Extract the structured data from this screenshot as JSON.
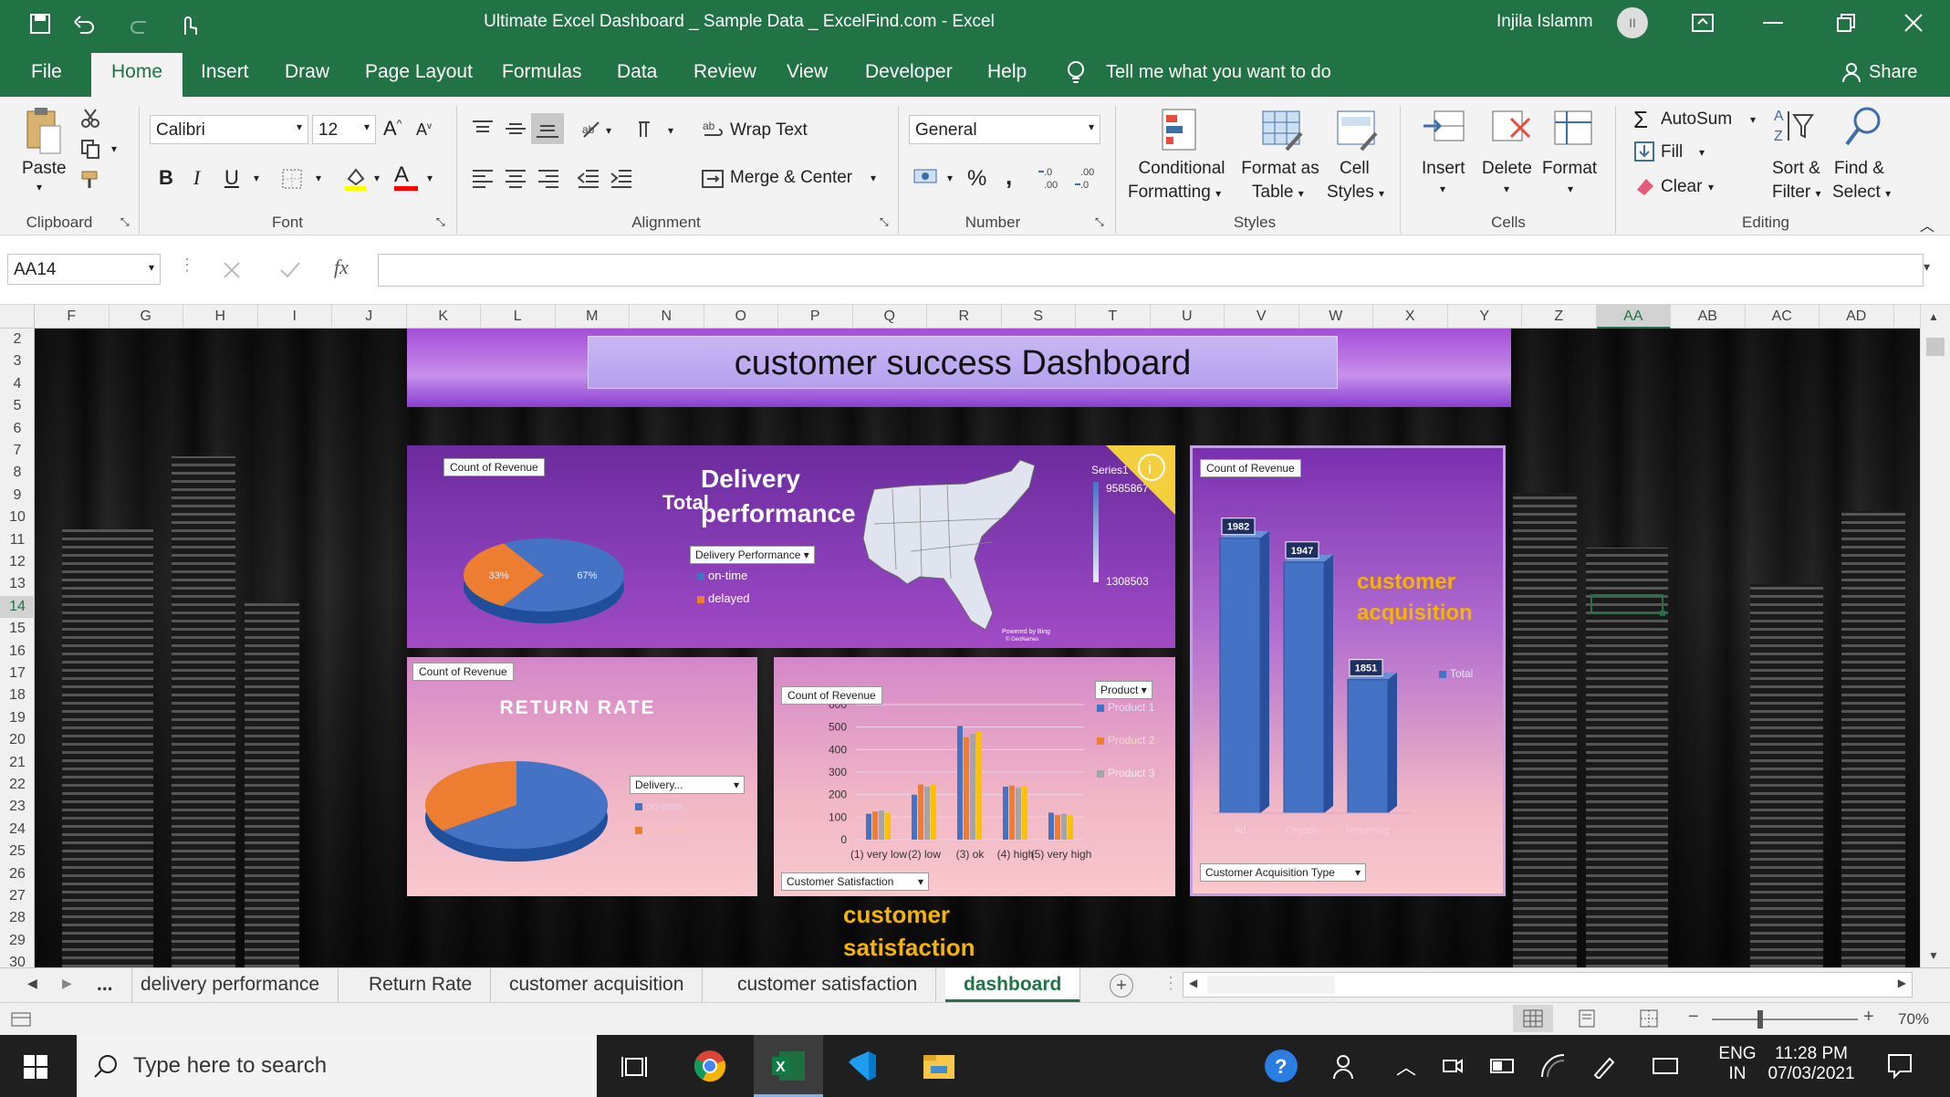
{
  "window": {
    "title": "Ultimate Excel Dashboard _ Sample Data _ ExcelFind.com  -  Excel",
    "user": "Injila Islamm",
    "user_initials": "II"
  },
  "tabs": [
    "File",
    "Home",
    "Insert",
    "Draw",
    "Page Layout",
    "Formulas",
    "Data",
    "Review",
    "View",
    "Developer",
    "Help"
  ],
  "tell_me": "Tell me what you want to do",
  "share": "Share",
  "ribbon": {
    "clipboard": {
      "paste": "Paste",
      "label": "Clipboard"
    },
    "font": {
      "name": "Calibri",
      "size": "12",
      "label": "Font",
      "bold": "B",
      "italic": "I",
      "underline": "U"
    },
    "alignment": {
      "wrap": "Wrap Text",
      "merge": "Merge & Center",
      "label": "Alignment"
    },
    "number": {
      "format": "General",
      "percent": "%",
      "comma": ",",
      "label": "Number"
    },
    "styles": {
      "conditional": "Conditional",
      "formatting": "Formatting",
      "format_as": "Format as",
      "table": "Table",
      "cell": "Cell",
      "cell_styles": "Styles",
      "label": "Styles"
    },
    "cells": {
      "insert": "Insert",
      "delete": "Delete",
      "format": "Format",
      "label": "Cells"
    },
    "editing": {
      "autosum": "AutoSum",
      "fill": "Fill",
      "clear": "Clear",
      "sort": "Sort &",
      "filter": "Filter",
      "find": "Find &",
      "select": "Select",
      "label": "Editing"
    }
  },
  "formula": {
    "namebox": "AA14",
    "fx": "fx",
    "value": ""
  },
  "columns": [
    "F",
    "G",
    "H",
    "I",
    "J",
    "K",
    "L",
    "M",
    "N",
    "O",
    "P",
    "Q",
    "R",
    "S",
    "T",
    "U",
    "V",
    "W",
    "X",
    "Y",
    "Z",
    "AA",
    "AB",
    "AC",
    "AD"
  ],
  "rows": [
    "2",
    "3",
    "4",
    "5",
    "6",
    "7",
    "8",
    "9",
    "10",
    "11",
    "12",
    "13",
    "14",
    "15",
    "16",
    "17",
    "18",
    "19",
    "20",
    "21",
    "22",
    "23",
    "24",
    "25",
    "26",
    "27",
    "28",
    "29",
    "30"
  ],
  "dashboard": {
    "title": "customer success Dashboard",
    "delivery": {
      "pill": "Count of Revenue",
      "title_line1": "Delivery",
      "title_line2": "performance",
      "total": "Total",
      "filter": "Delivery Performance",
      "legend": [
        "on-time",
        "delayed"
      ],
      "map_series": "Series1",
      "map_max": "9585867",
      "map_min": "1308503",
      "map_credit": "Powered by Bing",
      "map_credit2": "© GeoNames"
    },
    "return": {
      "pill": "Count of Revenue",
      "title": "RETURN RATE",
      "filter": "Delivery...",
      "legend": [
        "on-time",
        "delayed"
      ]
    },
    "satisfaction": {
      "pill": "Count of Revenue",
      "filter": "Product",
      "legend": [
        "Product 1",
        "Product 2",
        "Product 3"
      ],
      "axis_filter": "Customer Satisfaction",
      "caption_line1": "customer",
      "caption_line2": "satisfaction"
    },
    "acquisition": {
      "pill": "Count of Revenue",
      "title_line1": "customer",
      "title_line2": "acquisition",
      "legend": "Total",
      "filter": "Customer Acquisition Type"
    }
  },
  "chart_data": [
    {
      "type": "pie",
      "title": "Delivery performance",
      "categories": [
        "on-time",
        "delayed"
      ],
      "values": [
        67,
        33
      ],
      "labels": [
        "67%",
        "33%"
      ]
    },
    {
      "type": "pie",
      "title": "RETURN RATE",
      "categories": [
        "on-time",
        "delayed"
      ],
      "values": [
        65,
        35
      ]
    },
    {
      "type": "bar",
      "categories": [
        "(1) very low",
        "(2) low",
        "(3) ok",
        "(4) high",
        "(5) very high"
      ],
      "ylim": [
        0,
        600
      ],
      "yticks": [
        "0",
        "100",
        "200",
        "300",
        "400",
        "500",
        "600"
      ],
      "series": [
        {
          "name": "Product 1",
          "values": [
            115,
            200,
            505,
            235,
            120
          ]
        },
        {
          "name": "Product 2",
          "values": [
            125,
            245,
            455,
            240,
            110
          ]
        },
        {
          "name": "Product 3",
          "values": [
            130,
            235,
            470,
            230,
            115
          ]
        },
        {
          "name": "",
          "values": [
            120,
            245,
            480,
            240,
            110
          ]
        }
      ]
    },
    {
      "type": "bar",
      "categories": [
        "Ad",
        "Organic",
        "Returning"
      ],
      "values": [
        1982,
        1947,
        1851
      ],
      "labels": [
        "1982",
        "1947",
        "1851"
      ],
      "series": [
        {
          "name": "Total",
          "values": [
            1982,
            1947,
            1851
          ]
        }
      ]
    }
  ],
  "sheet_tabs": [
    "...",
    "delivery performance",
    "Return Rate",
    "customer acquisition",
    "customer satisfaction",
    "dashboard"
  ],
  "status": {
    "zoom": "70%"
  },
  "taskbar": {
    "search": "Type here to search",
    "lang1": "ENG",
    "lang2": "IN",
    "time": "11:28 PM",
    "date": "07/03/2021"
  },
  "colors": {
    "excel_green": "#217346",
    "bar_blue": "#4472c4",
    "bar_orange": "#ed7d31",
    "bar_gray": "#a5a5a5",
    "bar_yellow": "#ffc000",
    "gold": "#f4b400"
  }
}
